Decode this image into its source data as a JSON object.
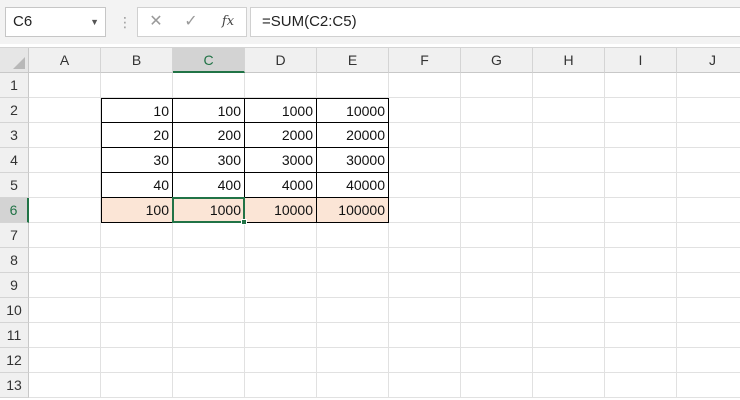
{
  "formula_bar": {
    "name_box": "C6",
    "cancel_icon": "✕",
    "enter_icon": "✓",
    "fx_label": "fx",
    "formula": "=SUM(C2:C5)"
  },
  "sheet": {
    "columns": [
      "A",
      "B",
      "C",
      "D",
      "E",
      "F",
      "G",
      "H",
      "I",
      "J"
    ],
    "rows": [
      "1",
      "2",
      "3",
      "4",
      "5",
      "6",
      "7",
      "8",
      "9",
      "10",
      "11",
      "12",
      "13"
    ],
    "selected_column": "C",
    "selected_row": "6",
    "active_cell": "C6",
    "sum_row_color": "#fbe5d6",
    "selection_color": "#217346",
    "table": [
      [
        "10",
        "100",
        "1000",
        "10000"
      ],
      [
        "20",
        "200",
        "2000",
        "20000"
      ],
      [
        "30",
        "300",
        "3000",
        "30000"
      ],
      [
        "40",
        "400",
        "4000",
        "40000"
      ],
      [
        "100",
        "1000",
        "10000",
        "100000"
      ]
    ]
  }
}
